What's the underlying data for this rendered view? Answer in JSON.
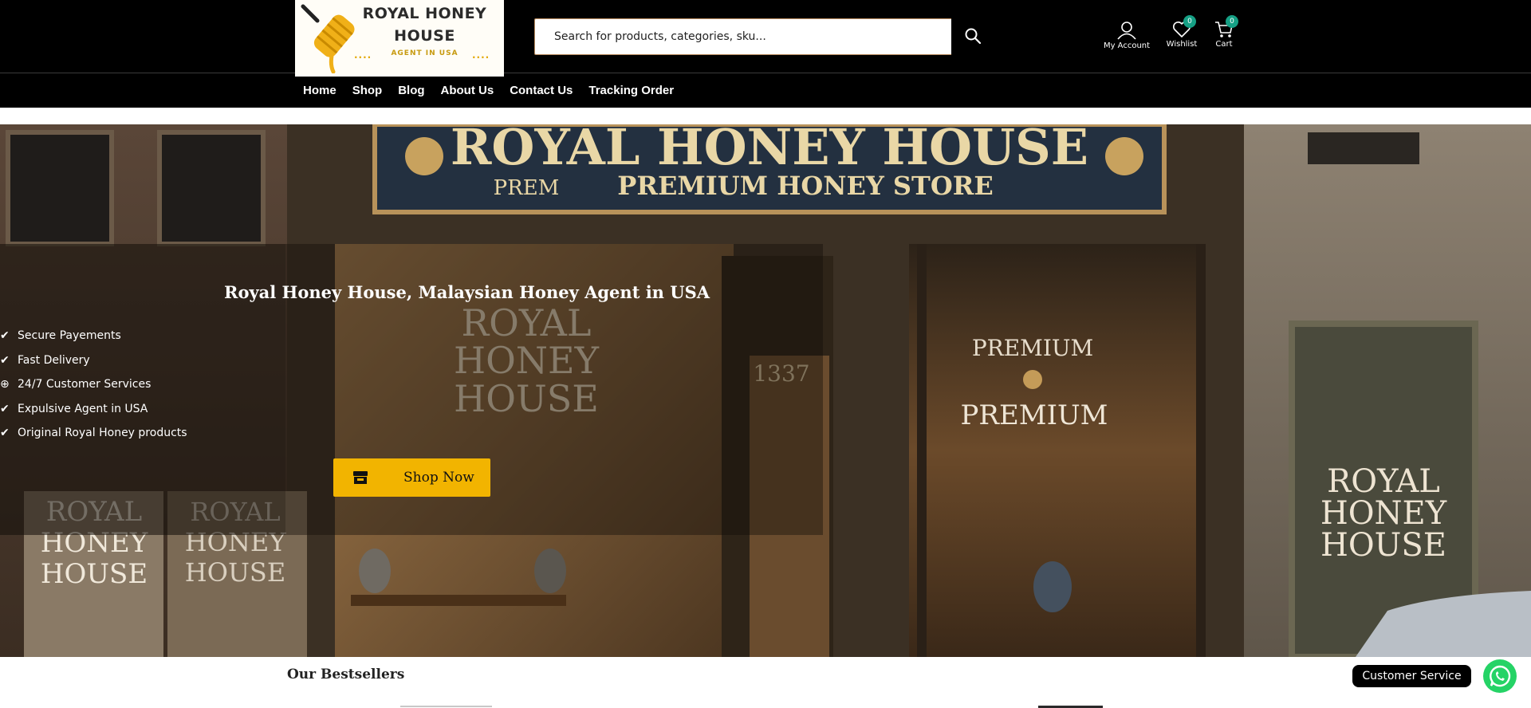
{
  "logo": {
    "line1": "ROYAL HONEY",
    "line2": "HOUSE",
    "tagline": "AGENT IN USA",
    "dots": "...."
  },
  "search": {
    "placeholder": "Search for products, categories, sku...",
    "icon": "search-icon"
  },
  "header_actions": [
    {
      "label": "My Account",
      "icon": "user-icon"
    },
    {
      "label": "Wishlist",
      "icon": "heart-icon",
      "count": "0"
    },
    {
      "label": "Cart",
      "icon": "cart-icon",
      "count": "0"
    }
  ],
  "nav": {
    "items": [
      "Home",
      "Shop",
      "Blog",
      "About Us",
      "Contact Us",
      "Tracking Order"
    ]
  },
  "hero": {
    "heading": "Royal Honey House, Malaysian Honey Agent in USA",
    "features": [
      {
        "label": "Secure Payements",
        "icon": "check-icon"
      },
      {
        "label": "Fast Delivery",
        "icon": "check-icon"
      },
      {
        "label": "24/7 Customer Services",
        "icon": "plus-circle-icon"
      },
      {
        "label": "Expulsive Agent in USA",
        "icon": "check-icon"
      },
      {
        "label": "Original Royal Honey products",
        "icon": "check-icon"
      }
    ],
    "cta_label": "Shop Now",
    "cta_icon": "store-icon",
    "sign_main": "ROYAL HONEY HOUSE",
    "sign_sub_left": "PREM",
    "sign_sub": "PREMIUM HONEY STORE",
    "window_text_1": [
      "ROYAL",
      "HONEY",
      "HOUSE"
    ],
    "window_number": "1337",
    "window_text_2a": "PREMIUM",
    "window_text_2b": "PREMIUM",
    "window_text_3": [
      "ROYAL",
      "HONEY",
      "HOUSE"
    ],
    "lower_left_text": [
      "ROYAL",
      "HONEY",
      "HOUSE"
    ],
    "lower_left_text_b": [
      "ROYAL",
      "HONEY",
      "HOUSE"
    ]
  },
  "section": {
    "bestsellers_title": "Our Bestsellers"
  },
  "support": {
    "customer_service_label": "Customer Service",
    "whatsapp_icon": "whatsapp-icon"
  },
  "colors": {
    "brand_gold": "#f2b400",
    "header_bg": "#000000",
    "badge_green": "#16a085",
    "whatsapp_green": "#25d366"
  }
}
